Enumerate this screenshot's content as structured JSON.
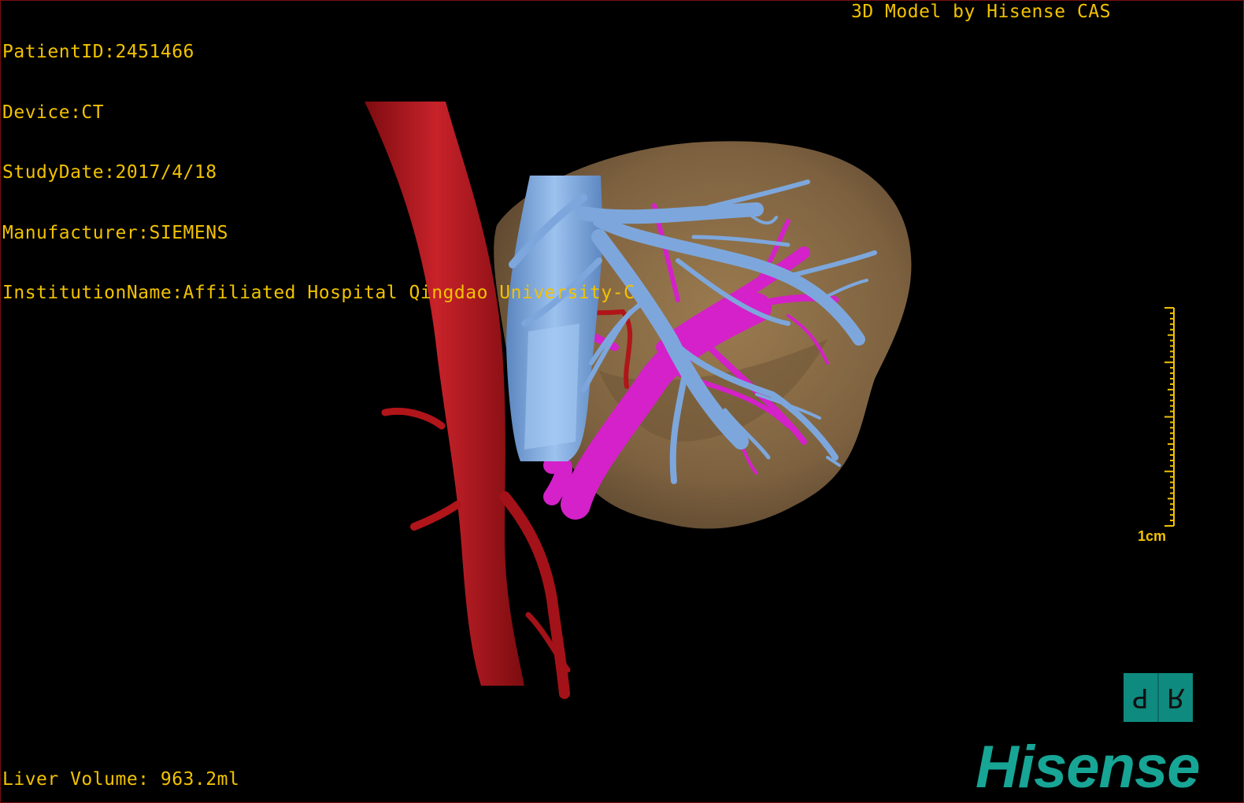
{
  "overlay": {
    "patient_id": "PatientID:2451466",
    "device": "Device:CT",
    "study_date": "StudyDate:2017/4/18",
    "manufacturer": "Manufacturer:SIEMENS",
    "institution": "InstitutionName:Affiliated Hospital Qingdao University-C",
    "credit": "3D Model by Hisense CAS",
    "liver_volume": "Liver Volume: 963.2ml"
  },
  "ruler": {
    "label": "1cm"
  },
  "orientation": {
    "left_letter": "P",
    "right_letter": "R"
  },
  "brand": {
    "logo_text": "Hisense"
  },
  "colors": {
    "overlay_text": "#f2c200",
    "liver": "#8a6d45",
    "aorta": "#b0151a",
    "ivc": "#7da7dc",
    "portal_vein": "#d421c9",
    "brand": "#17a596"
  },
  "model": {
    "structures": [
      "liver",
      "aorta",
      "inferior vena cava",
      "hepatic veins",
      "portal vein",
      "hepatic artery"
    ]
  }
}
